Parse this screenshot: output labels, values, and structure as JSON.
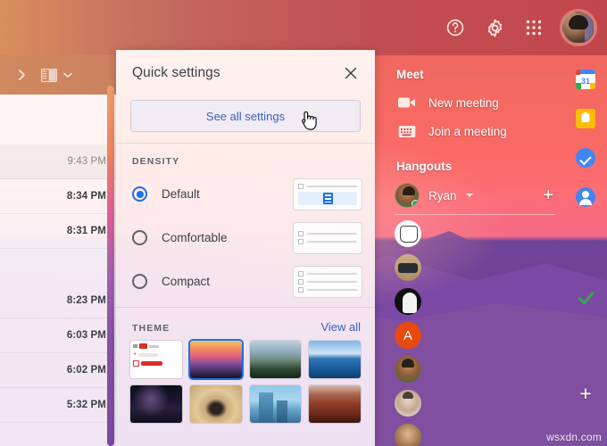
{
  "topbar": {
    "icons": [
      {
        "name": "help-icon",
        "label": "Support"
      },
      {
        "name": "gear-icon",
        "label": "Settings"
      },
      {
        "name": "apps-grid-icon",
        "label": "Google apps"
      }
    ],
    "avatar_label": "Google Account"
  },
  "left_pane": {
    "toolbar": {
      "expand_label": "Expand",
      "split_pane_label": "Toggle split pane mode",
      "caret_label": "More options"
    },
    "rows": [
      {
        "time": "9:43 PM",
        "unread": true
      },
      {
        "time": "8:34 PM",
        "unread": false
      },
      {
        "time": "8:31 PM",
        "unread": false
      },
      {
        "time": "",
        "unread": false
      },
      {
        "time": "8:23 PM",
        "unread": false
      },
      {
        "time": "6:03 PM",
        "unread": false
      },
      {
        "time": "6:02 PM",
        "unread": false
      },
      {
        "time": "5:32 PM",
        "unread": false
      }
    ]
  },
  "quick_settings": {
    "title": "Quick settings",
    "close_label": "Close",
    "see_all_label": "See all settings",
    "density": {
      "label": "DENSITY",
      "options": [
        {
          "label": "Default",
          "selected": true
        },
        {
          "label": "Comfortable",
          "selected": false
        },
        {
          "label": "Compact",
          "selected": false
        }
      ]
    },
    "theme": {
      "label": "THEME",
      "view_all_label": "View all",
      "thumbs": [
        {
          "name": "theme-default-gmail",
          "selected": false
        },
        {
          "name": "theme-sunset",
          "selected": true
        },
        {
          "name": "theme-mountains",
          "selected": false
        },
        {
          "name": "theme-lake",
          "selected": false
        },
        {
          "name": "theme-night-sky",
          "selected": false
        },
        {
          "name": "theme-desert",
          "selected": false
        },
        {
          "name": "theme-city",
          "selected": false
        },
        {
          "name": "theme-canyon",
          "selected": false
        }
      ]
    }
  },
  "meet": {
    "heading": "Meet",
    "items": [
      {
        "label": "New meeting",
        "icon": "video-camera-icon"
      },
      {
        "label": "Join a meeting",
        "icon": "keyboard-icon"
      }
    ]
  },
  "hangouts": {
    "heading": "Hangouts",
    "me": {
      "name": "Ryan",
      "status": "online"
    },
    "add_label": "+",
    "contacts": [
      {
        "name": "contact-drum",
        "initial": ""
      },
      {
        "name": "contact-jeep",
        "initial": ""
      },
      {
        "name": "contact-portrait-bw",
        "initial": ""
      },
      {
        "name": "contact-letter-a",
        "initial": "A"
      },
      {
        "name": "contact-man-1",
        "initial": ""
      },
      {
        "name": "contact-man-2",
        "initial": ""
      },
      {
        "name": "contact-man-3",
        "initial": ""
      }
    ]
  },
  "app_rail": {
    "items": [
      {
        "name": "google-calendar-icon",
        "label": "Calendar",
        "day": "31"
      },
      {
        "name": "google-keep-icon",
        "label": "Keep"
      },
      {
        "name": "google-tasks-icon",
        "label": "Tasks"
      },
      {
        "name": "google-contacts-icon",
        "label": "Contacts"
      },
      {
        "name": "green-check-icon",
        "label": "Add-on"
      }
    ],
    "add_label": "+"
  },
  "watermark": "wsxdn.com",
  "colors": {
    "accent_blue": "#1a73e8",
    "link_blue": "#3b5fc0",
    "header_left": "#d98f5e",
    "header_right": "#c0464b",
    "status_green": "#34a853"
  }
}
